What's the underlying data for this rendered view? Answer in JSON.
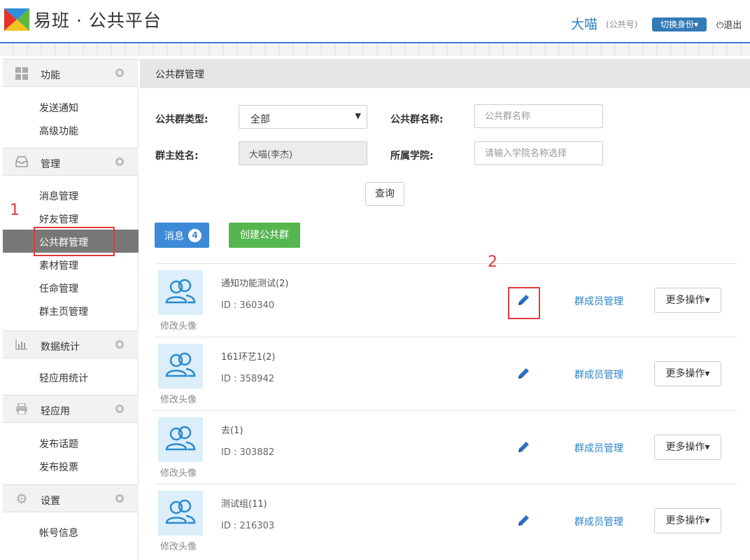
{
  "header": {
    "logo_text": "易班 · 公共平台",
    "user_name": "大喵",
    "user_role": "(公共号)",
    "switch_label": "切换身份▾",
    "logout_label": "退出",
    "accent_color": "#2b83c9"
  },
  "sidebar": {
    "sections": [
      {
        "label": "功能",
        "icon": "grid-icon",
        "items": [
          "发送通知",
          "高级功能"
        ]
      },
      {
        "label": "管理",
        "icon": "inbox-icon",
        "items": [
          "消息管理",
          "好友管理",
          "公共群管理",
          "素材管理",
          "任命管理",
          "群主页管理"
        ]
      },
      {
        "label": "数据统计",
        "icon": "bar-chart-icon",
        "items": [
          "轻应用统计"
        ]
      },
      {
        "label": "轻应用",
        "icon": "printer-icon",
        "items": [
          "发布话题",
          "发布投票"
        ]
      },
      {
        "label": "设置",
        "icon": "gear-icon",
        "items": [
          "帐号信息"
        ]
      }
    ],
    "active_item": "公共群管理"
  },
  "annotations": {
    "step1": "1",
    "step2": "2"
  },
  "main": {
    "breadcrumb": "公共群管理",
    "filters": {
      "type_label": "公共群类型:",
      "type_value": "全部",
      "name_label": "公共群名称:",
      "name_placeholder": "公共群名称",
      "owner_label": "群主姓名:",
      "owner_value": "大喵(李杰)",
      "college_label": "所属学院:",
      "college_placeholder": "请输入学院名称选择",
      "query_label": "查询"
    },
    "message_button": {
      "label": "消息",
      "badge": "4"
    },
    "create_button_label": "创建公共群",
    "avatar_link_label": "修改头像",
    "members_link_label": "群成员管理",
    "more_button_label": "更多操作▾",
    "groups": [
      {
        "name": "通知功能测试(2)",
        "id": "ID : 360340"
      },
      {
        "name": "161环艺1(2)",
        "id": "ID : 358942"
      },
      {
        "name": "去(1)",
        "id": "ID : 303882"
      },
      {
        "name": "测试组(11)",
        "id": "ID : 216303"
      }
    ]
  }
}
